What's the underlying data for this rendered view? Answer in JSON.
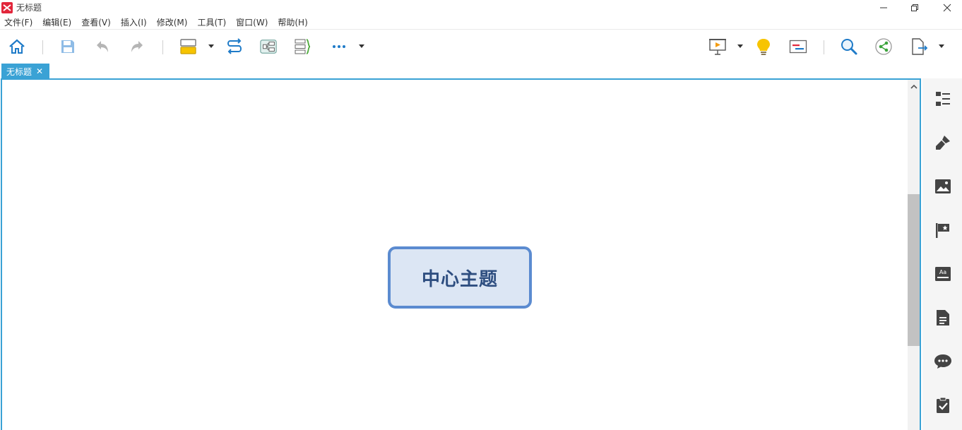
{
  "window": {
    "title": "无标题",
    "logo_icon": "xmind-logo-icon",
    "controls": [
      "minimize-icon",
      "restore-icon",
      "close-icon"
    ]
  },
  "menubar": {
    "items": [
      "文件(F)",
      "编辑(E)",
      "查看(V)",
      "插入(I)",
      "修改(M)",
      "工具(T)",
      "窗口(W)",
      "帮助(H)"
    ]
  },
  "toolbar": {
    "items": [
      {
        "name": "home-icon"
      },
      {
        "name": "save-icon"
      },
      {
        "name": "undo-icon"
      },
      {
        "name": "redo-icon"
      },
      {
        "name": "insert-topic-icon"
      },
      {
        "name": "relationship-icon"
      },
      {
        "name": "boundary-icon"
      },
      {
        "name": "summary-icon"
      },
      {
        "name": "more-icon"
      },
      {
        "name": "presentation-icon"
      },
      {
        "name": "idea-bulb-icon"
      },
      {
        "name": "gantt-icon"
      },
      {
        "name": "search-icon"
      },
      {
        "name": "share-icon"
      },
      {
        "name": "export-icon"
      }
    ]
  },
  "tabs": {
    "active_label": "无标题",
    "close_glyph": "✕"
  },
  "canvas": {
    "central_topic": "中心主题"
  },
  "right_panel": {
    "items": [
      "outline-icon",
      "format-brush-icon",
      "image-icon",
      "marker-flag-icon",
      "label-icon",
      "notes-icon",
      "comments-icon",
      "task-icon"
    ]
  },
  "colors": {
    "accent": "#3aa2d5",
    "topic_fill": "#dce6f4",
    "topic_border": "#5b8bd0",
    "topic_text": "#2e4e80"
  }
}
